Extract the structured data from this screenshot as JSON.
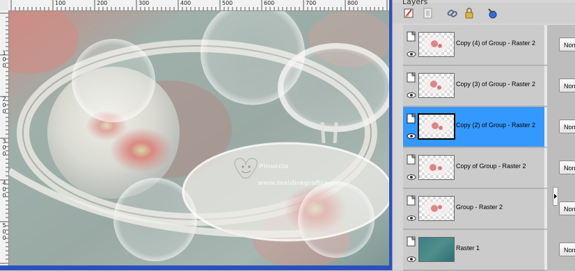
{
  "palette": {
    "title": "Layers",
    "toolbar": [
      {
        "icon": "new-raster-layer-icon"
      },
      {
        "icon": "new-mask-layer-icon"
      },
      {
        "icon": "link-icon"
      },
      {
        "icon": "lock-icon"
      },
      {
        "icon": "layer-properties-icon"
      }
    ],
    "layers": [
      {
        "name": "Copy (4) of Group - Raster 2",
        "blend": "Normal",
        "selected": false,
        "thumb": "floral"
      },
      {
        "name": "Copy (3) of Group - Raster 2",
        "blend": "Normal",
        "selected": false,
        "thumb": "floral"
      },
      {
        "name": "Copy (2) of Group - Raster 2",
        "blend": "Normal",
        "selected": true,
        "thumb": "floral"
      },
      {
        "name": "Copy of Group - Raster 2",
        "blend": "Normal",
        "selected": false,
        "thumb": "floral"
      },
      {
        "name": "Group - Raster 2",
        "blend": "Normal",
        "selected": false,
        "thumb": "floral"
      },
      {
        "name": "Raster 1",
        "blend": "Normal",
        "selected": false,
        "thumb": "gradient"
      }
    ]
  },
  "ruler": {
    "horizontal": [
      "100",
      "200",
      "300",
      "400",
      "500",
      "600",
      "700",
      "800"
    ],
    "vertical": [
      "1",
      "0",
      "0",
      "2",
      "0",
      "0",
      "3",
      "0",
      "0",
      "4",
      "0",
      "0",
      "5",
      "0",
      "0"
    ]
  },
  "watermark": {
    "line1": "Pinuccia",
    "line2": "www.maidiregrafica.eu"
  },
  "colors": {
    "selection": "#3399ff",
    "window_frame": "#2a52be"
  }
}
